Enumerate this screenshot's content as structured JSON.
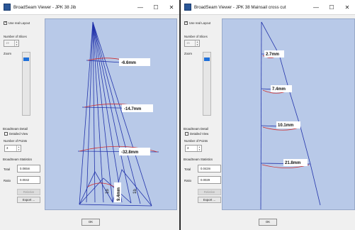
{
  "windows": [
    {
      "title": "BroadSeam Viewer - JPK 38 Jib",
      "controls": {
        "minimize": "—",
        "maximize": "☐",
        "close": "✕"
      },
      "sidebar": {
        "use_real_layout": "Use real Layout",
        "number_of_slices_label": "Number of Slices",
        "number_of_slices_value": "19",
        "zoom_label": "Zoom",
        "zoom_level": 0.92,
        "broadseam_detail_label": "BroadSeam Detail",
        "detailed_view": "Detailed View",
        "number_of_points_label": "Number of Points",
        "number_of_points_value": "3",
        "broadseam_statistics_label": "BroadSeam Statistics",
        "total_label": "Total",
        "total_value": "0.065m",
        "ratio_label": "Ratio",
        "ratio_value": "0.0042",
        "relative_button": "Relative",
        "export_button": "Export ..."
      },
      "canvas_labels": [
        "-6.6mm",
        "-14.7mm",
        "-32.8mm",
        "9.4mm",
        "1b",
        "1b"
      ],
      "ok_button": "OK"
    },
    {
      "title": "BroadSeam Viewer - JPK 38 Mainsail cross cut",
      "controls": {
        "minimize": "—",
        "maximize": "☐",
        "close": "✕"
      },
      "sidebar": {
        "use_real_layout": "Use real Layout",
        "number_of_slices_label": "Number of Slices",
        "number_of_slices_value": "15",
        "zoom_label": "Zoom",
        "zoom_level": 0.92,
        "broadseam_detail_label": "BroadSeam Detail",
        "detailed_view": "Detailed View",
        "number_of_points_label": "Number of Points",
        "number_of_points_value": "3",
        "broadseam_statistics_label": "BroadSeam Statistics",
        "total_label": "Total",
        "total_value": "0.042m",
        "ratio_label": "Ratio",
        "ratio_value": "0.0029",
        "relative_button": "Relative",
        "export_button": "Export ..."
      },
      "canvas_labels": [
        "2.7mm",
        "7.4mm",
        "10.1mm",
        "21.8mm"
      ],
      "ok_button": "OK"
    }
  ],
  "colors": {
    "canvas_bg": "#b8c9e8",
    "sail_line": "#2233aa",
    "seam_curve": "#d03030",
    "zoom_thumb": "#1e6fd9"
  }
}
